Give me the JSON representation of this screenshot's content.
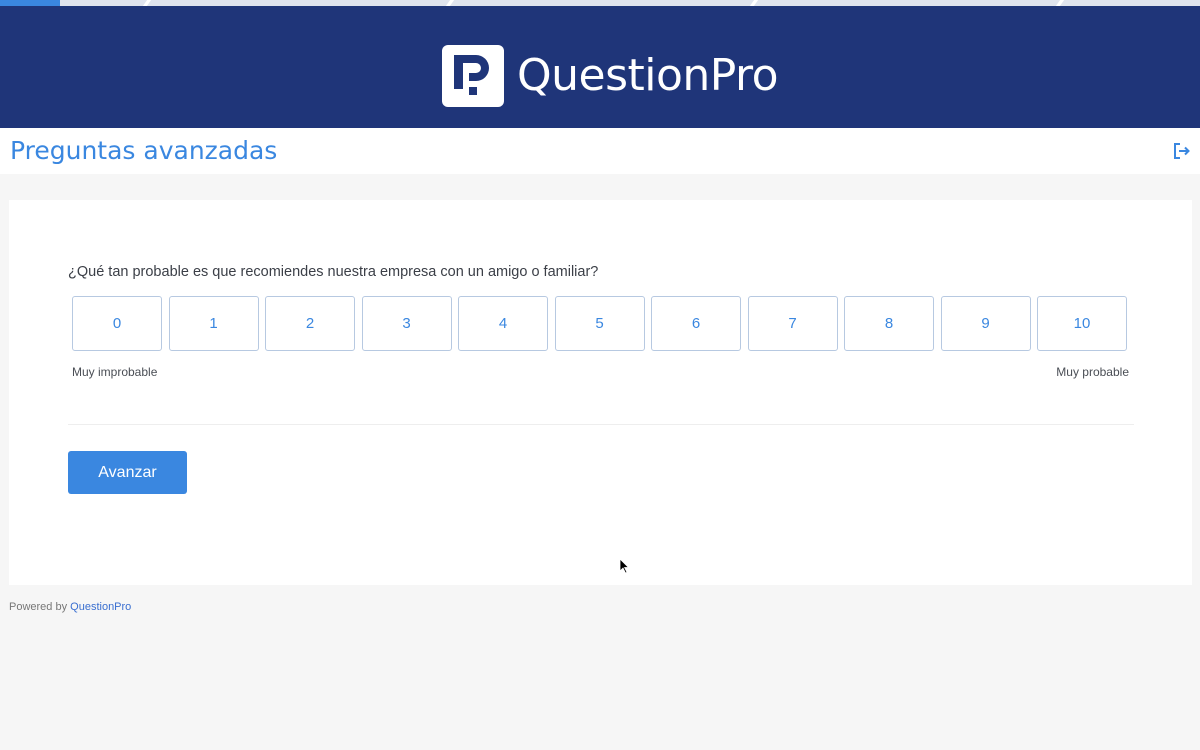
{
  "header": {
    "brand": "QuestionPro",
    "bg_color": "#1f3579"
  },
  "progress": {
    "fraction": 0.05
  },
  "page": {
    "title": "Preguntas avanzadas",
    "accent_color": "#3a87e0",
    "exit_icon": "exit-icon"
  },
  "survey": {
    "question": "¿Qué tan probable es que recomiendes nuestra empresa con un amigo o familiar?",
    "scale": [
      "0",
      "1",
      "2",
      "3",
      "4",
      "5",
      "6",
      "7",
      "8",
      "9",
      "10"
    ],
    "anchor_low": "Muy improbable",
    "anchor_high": "Muy probable",
    "next_label": "Avanzar"
  },
  "footer": {
    "powered_by": "Powered by",
    "link": "QuestionPro"
  }
}
